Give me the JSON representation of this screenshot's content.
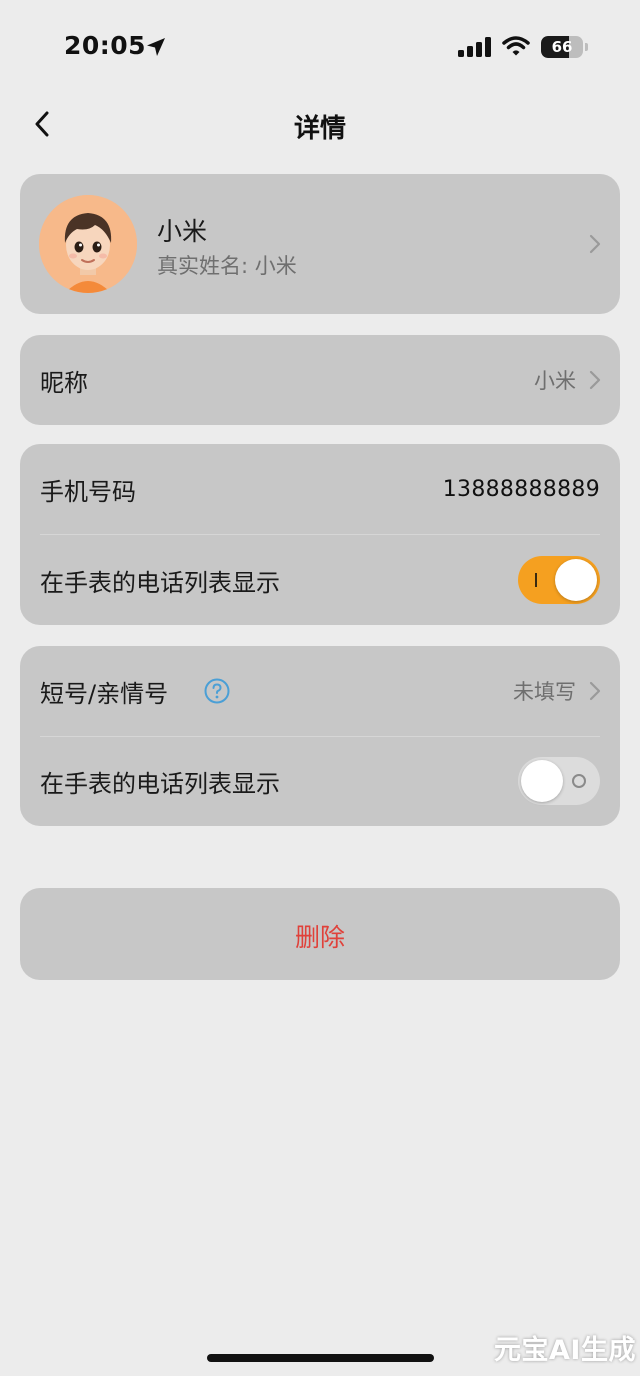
{
  "status_bar": {
    "time": "20:05",
    "battery": "66",
    "battery_level": 0.66,
    "icons": [
      "location-arrow-icon",
      "cellular-signal-icon",
      "wifi-icon",
      "battery-icon"
    ]
  },
  "nav": {
    "title": "详情",
    "back_icon": "chevron-left-icon"
  },
  "profile": {
    "name": "小米",
    "real_name": "真实姓名: 小米",
    "avatar": "cartoon-boy-avatar"
  },
  "nickname": {
    "label": "昵称",
    "value": "小米"
  },
  "phone": {
    "label": "手机号码",
    "value": "13888888889",
    "show_label": "在手表的电话列表显示",
    "show_enabled": true
  },
  "short_number": {
    "label": "短号/亲情号",
    "value": "未填写",
    "help_icon": "question-circle-icon",
    "show_label": "在手表的电话列表显示",
    "show_enabled": false
  },
  "delete": {
    "label": "删除"
  },
  "watermark": "元宝AI生成",
  "colors": {
    "background": "#ececec",
    "card": "#c7c7c7",
    "accent": "#f5a020",
    "danger": "#e0413a",
    "help": "#4a9fd6"
  }
}
